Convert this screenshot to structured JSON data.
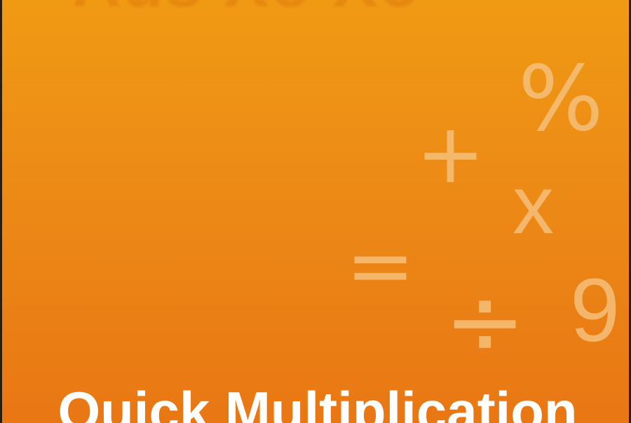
{
  "cover": {
    "top_partial_text": "Aus Xo Xo",
    "title": "Quick Multiplication",
    "background_top_color": "#f09a14",
    "background_bottom_color": "#e97714",
    "symbol_color": "#f6c07a"
  },
  "symbols": {
    "percent": "%",
    "plus": "+",
    "times": "x",
    "equals": "=",
    "divide": "÷",
    "nine": "9"
  }
}
